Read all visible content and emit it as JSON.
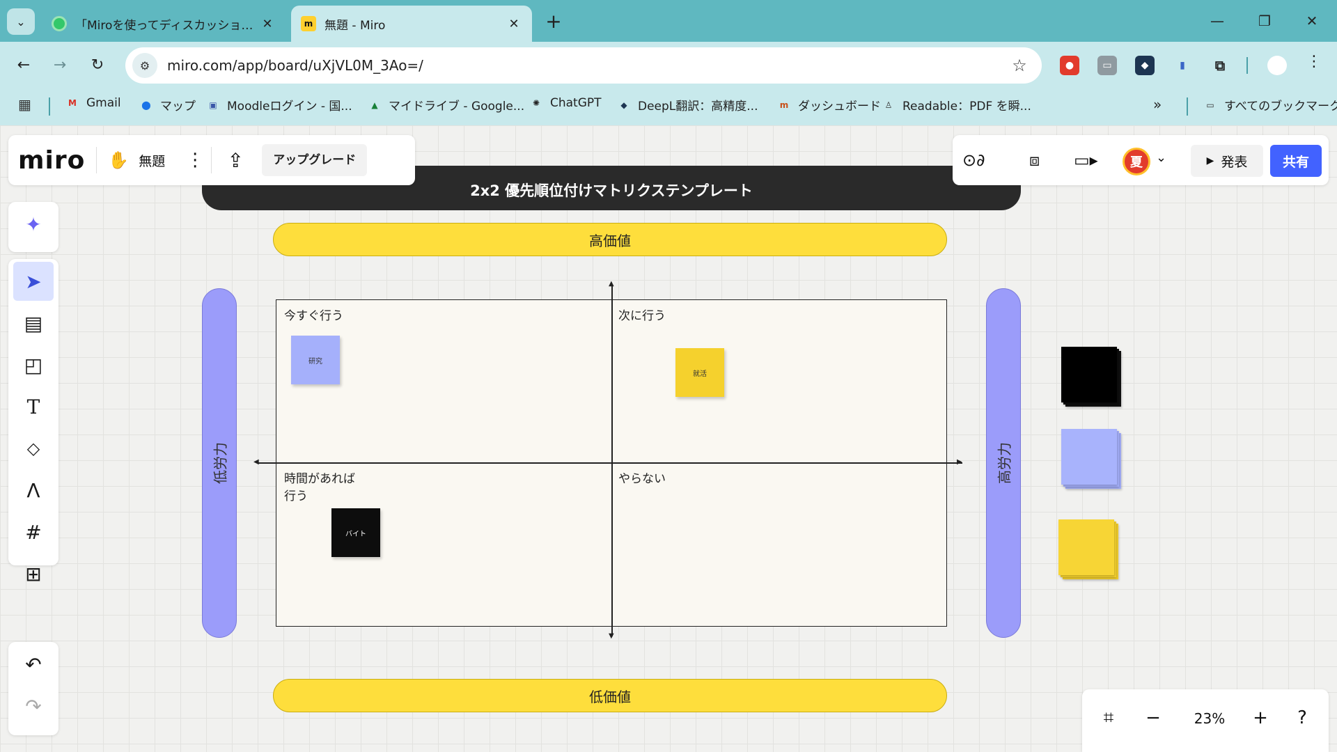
{
  "browser": {
    "tabs": [
      {
        "title": "「Miroを使ってディスカッションをオン",
        "active": false
      },
      {
        "title": "無題 - Miro",
        "active": true
      }
    ],
    "new_tab": "+",
    "url": "miro.com/app/board/uXjVL0M_3Ao=/",
    "bookmarks": [
      {
        "label": "Gmail"
      },
      {
        "label": "マップ"
      },
      {
        "label": "Moodleログイン - 国..."
      },
      {
        "label": "マイドライブ - Google..."
      },
      {
        "label": "ChatGPT"
      },
      {
        "label": "DeepL翻訳：高精度..."
      },
      {
        "label": "ダッシュボード"
      },
      {
        "label": "Readable：PDF を瞬..."
      }
    ],
    "bookmarks_more": "»",
    "all_bookmarks": "すべてのブックマーク"
  },
  "miro": {
    "logo": "miro",
    "board_name": "無題",
    "upgrade": "アップグレード",
    "present": "発表",
    "share": "共有",
    "user_initial": "夏",
    "zoom": "23%"
  },
  "board": {
    "title": "2x2 優先順位付けマトリクステンプレート",
    "high_value": "高価値",
    "low_value": "低価値",
    "low_effort": "低労力",
    "high_effort": "高労力",
    "quadrants": {
      "top_left": "今すぐ行う",
      "top_right": "次に行う",
      "bottom_left": "時間があれば\n行う",
      "bottom_right": "やらない"
    },
    "stickies": [
      {
        "text": "研究",
        "color": "#a5b0fb"
      },
      {
        "text": "就活",
        "color": "#f5d12d"
      },
      {
        "text": "バイト",
        "color": "#0d0d0d"
      }
    ]
  },
  "colors": {
    "accent": "#4262ff",
    "yellow": "#fede3c",
    "purple": "#9b9cfa",
    "chrome": "#5fb8c0"
  }
}
